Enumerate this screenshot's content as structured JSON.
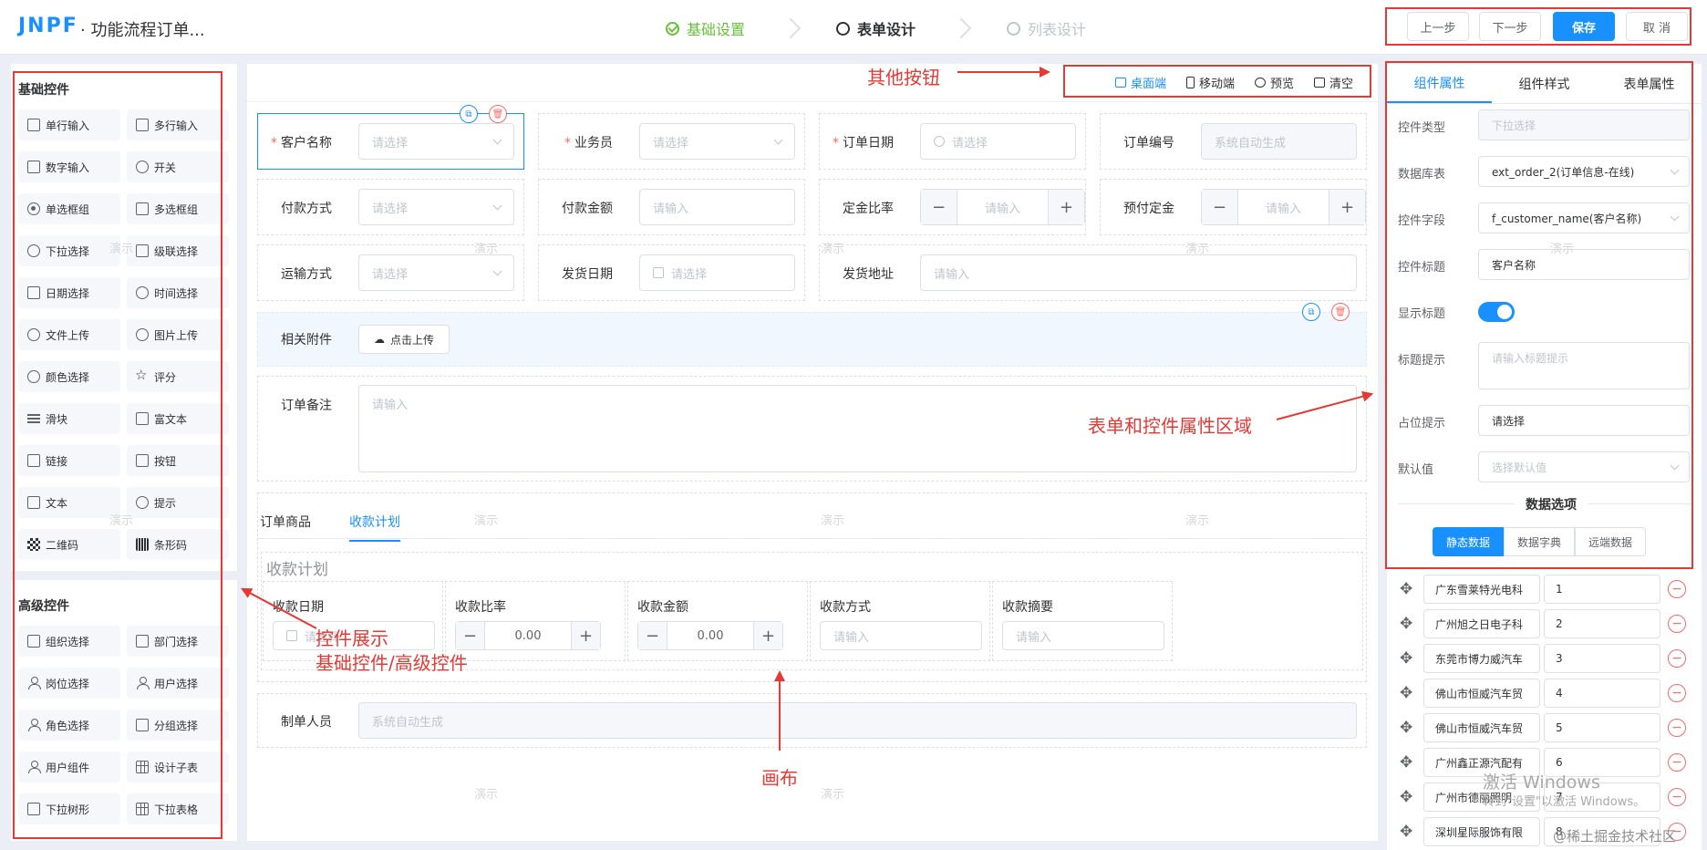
{
  "header": {
    "logo": "JNPF",
    "title": "· 功能流程订单...",
    "steps": [
      {
        "label": "基础设置",
        "state": "done"
      },
      {
        "label": "表单设计",
        "state": "active"
      },
      {
        "label": "列表设计",
        "state": "todo"
      }
    ],
    "buttons": {
      "prev": "上一步",
      "next": "下一步",
      "save": "保存",
      "cancel": "取 消"
    }
  },
  "sidebar": {
    "basic_title": "基础控件",
    "basic_items": [
      {
        "label": "单行输入",
        "icon": "input-icon"
      },
      {
        "label": "多行输入",
        "icon": "textarea-icon"
      },
      {
        "label": "数字输入",
        "icon": "number-icon"
      },
      {
        "label": "开关",
        "icon": "switch-icon"
      },
      {
        "label": "单选框组",
        "icon": "radio-icon"
      },
      {
        "label": "多选框组",
        "icon": "checkbox-icon"
      },
      {
        "label": "下拉选择",
        "icon": "select-icon"
      },
      {
        "label": "级联选择",
        "icon": "cascader-icon"
      },
      {
        "label": "日期选择",
        "icon": "calendar-icon"
      },
      {
        "label": "时间选择",
        "icon": "clock-icon"
      },
      {
        "label": "文件上传",
        "icon": "upload-icon"
      },
      {
        "label": "图片上传",
        "icon": "image-upload-icon"
      },
      {
        "label": "颜色选择",
        "icon": "palette-icon"
      },
      {
        "label": "评分",
        "icon": "star-icon"
      },
      {
        "label": "滑块",
        "icon": "slider-icon"
      },
      {
        "label": "富文本",
        "icon": "richtext-icon"
      },
      {
        "label": "链接",
        "icon": "link-icon"
      },
      {
        "label": "按钮",
        "icon": "button-icon"
      },
      {
        "label": "文本",
        "icon": "text-icon"
      },
      {
        "label": "提示",
        "icon": "alert-icon"
      },
      {
        "label": "二维码",
        "icon": "qrcode-icon"
      },
      {
        "label": "条形码",
        "icon": "barcode-icon"
      }
    ],
    "advanced_title": "高级控件",
    "advanced_items": [
      {
        "label": "组织选择",
        "icon": "org-icon"
      },
      {
        "label": "部门选择",
        "icon": "department-icon"
      },
      {
        "label": "岗位选择",
        "icon": "position-icon"
      },
      {
        "label": "用户选择",
        "icon": "user-icon"
      },
      {
        "label": "角色选择",
        "icon": "role-icon"
      },
      {
        "label": "分组选择",
        "icon": "group-icon"
      },
      {
        "label": "用户组件",
        "icon": "user-component-icon"
      },
      {
        "label": "设计子表",
        "icon": "table-icon"
      },
      {
        "label": "下拉树形",
        "icon": "tree-icon"
      },
      {
        "label": "下拉表格",
        "icon": "table-select-icon"
      }
    ]
  },
  "canvas_toolbar": {
    "desktop": "桌面端",
    "mobile": "移动端",
    "preview": "预览",
    "clear": "清空"
  },
  "form": {
    "customer_name": {
      "label": "客户名称",
      "placeholder": "请选择"
    },
    "salesman": {
      "label": "业务员",
      "placeholder": "请选择"
    },
    "order_date": {
      "label": "订单日期",
      "placeholder": "请选择"
    },
    "order_no": {
      "label": "订单编号",
      "placeholder": "系统自动生成"
    },
    "pay_method": {
      "label": "付款方式",
      "placeholder": "请选择"
    },
    "pay_amount": {
      "label": "付款金额",
      "placeholder": "请输入"
    },
    "deposit_rate": {
      "label": "定金比率",
      "placeholder": "请输入"
    },
    "prepaid_deposit": {
      "label": "预付定金",
      "placeholder": "请输入"
    },
    "shipping_method": {
      "label": "运输方式",
      "placeholder": "请选择"
    },
    "ship_date": {
      "label": "发货日期",
      "placeholder": "请选择"
    },
    "ship_address": {
      "label": "发货地址",
      "placeholder": "请输入"
    },
    "attachment": {
      "label": "相关附件",
      "button": "点击上传"
    },
    "remark": {
      "label": "订单备注",
      "placeholder": "请输入"
    },
    "tabs": [
      "订单商品",
      "收款计划"
    ],
    "plan_title": "收款计划",
    "plan_columns": [
      {
        "label": "收款日期",
        "placeholder": "请选择"
      },
      {
        "label": "收款比率",
        "value": "0.00"
      },
      {
        "label": "收款金额",
        "value": "0.00"
      },
      {
        "label": "收款方式",
        "placeholder": "请输入"
      },
      {
        "label": "收款摘要",
        "placeholder": "请输入"
      }
    ],
    "creator": {
      "label": "制单人员",
      "placeholder": "系统自动生成"
    }
  },
  "props_panel": {
    "tabs": [
      "组件属性",
      "组件样式",
      "表单属性"
    ],
    "rows": [
      {
        "label": "控件类型",
        "value": "下拉选择"
      },
      {
        "label": "数据库表",
        "value": "ext_order_2(订单信息-在线)"
      },
      {
        "label": "控件字段",
        "value": "f_customer_name(客户名称)"
      },
      {
        "label": "控件标题",
        "value": "客户名称"
      },
      {
        "label": "显示标题",
        "value": ""
      },
      {
        "label": "标题提示",
        "value": "请输入标题提示"
      },
      {
        "label": "占位提示",
        "value": "请选择"
      },
      {
        "label": "默认值",
        "value": "选择默认值"
      }
    ],
    "show_title_on": true,
    "data_options_title": "数据选项",
    "data_source_buttons": [
      "静态数据",
      "数据字典",
      "远端数据"
    ],
    "options": [
      {
        "label": "广东雪莱特光电科",
        "value": "1"
      },
      {
        "label": "广州旭之日电子科",
        "value": "2"
      },
      {
        "label": "东莞市博力威汽车",
        "value": "3"
      },
      {
        "label": "佛山市恒威汽车贸",
        "value": "4"
      },
      {
        "label": "佛山市恒威汽车贸",
        "value": "5"
      },
      {
        "label": "广州鑫正源汽配有",
        "value": "6"
      },
      {
        "label": "广州市德丽照明",
        "value": "7"
      },
      {
        "label": "深圳星际服饰有限",
        "value": "8"
      }
    ]
  },
  "annotations": {
    "other_buttons": "其他按钮",
    "props_area": "表单和控件属性区域",
    "controls_line1": "控件展示",
    "controls_line2": "基础控件/高级控件",
    "canvas": "画布"
  },
  "watermarks": {
    "sample": "演示",
    "activate": "激活 Windows",
    "activate_sub": "转到\"设置\"以激活 Windows。",
    "site": "@稀土掘金技术社区"
  },
  "colors": {
    "primary": "#1890ff",
    "annotation": "#e53935",
    "success": "#67c23a",
    "danger": "#f56c6c"
  }
}
